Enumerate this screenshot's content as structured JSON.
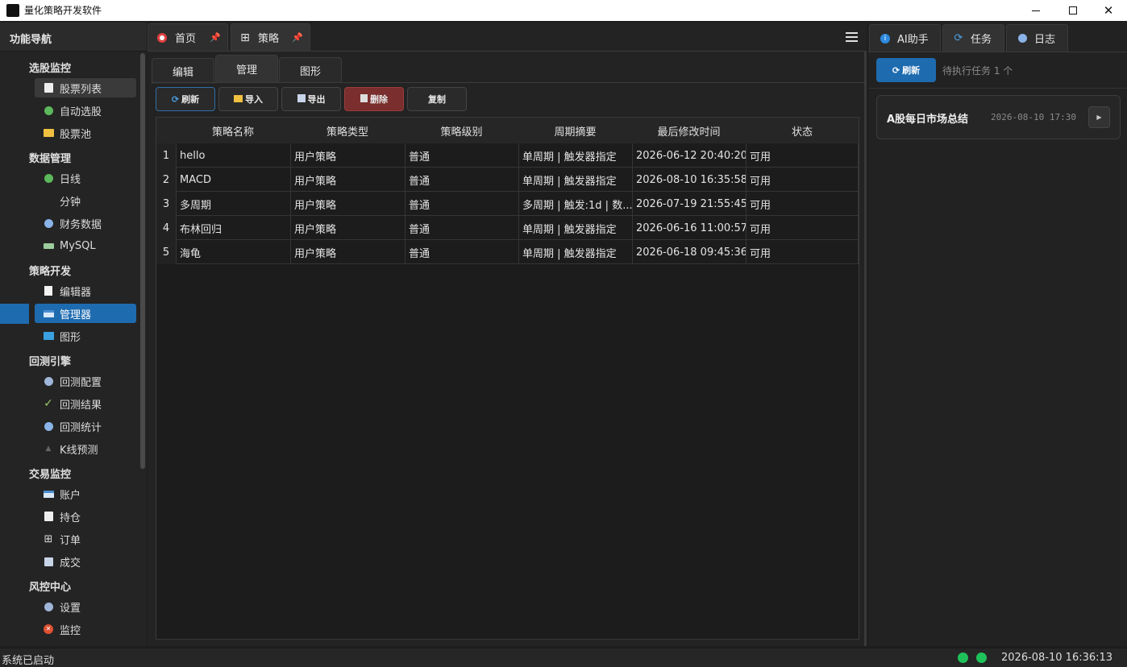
{
  "window": {
    "title": "量化策略开发软件"
  },
  "nav": {
    "header": "功能导航",
    "groups": [
      {
        "label": "选股监控",
        "items": [
          "股票列表",
          "自动选股",
          "股票池"
        ]
      },
      {
        "label": "数据管理",
        "items": [
          "日线",
          "分钟",
          "财务数据",
          "MySQL"
        ]
      },
      {
        "label": "策略开发",
        "items": [
          "编辑器",
          "管理器",
          "图形"
        ]
      },
      {
        "label": "回测引擎",
        "items": [
          "回测配置",
          "回测结果",
          "回测统计",
          "K线预测"
        ]
      },
      {
        "label": "交易监控",
        "items": [
          "账户",
          "持仓",
          "订单",
          "成交"
        ]
      },
      {
        "label": "风控中心",
        "items": [
          "设置",
          "监控"
        ]
      }
    ],
    "selected": "管理器",
    "hovered": "股票列表"
  },
  "tabs": {
    "home": "首页",
    "strategy": "策略"
  },
  "subtabs": {
    "edit": "编辑",
    "manage": "管理",
    "chart": "图形"
  },
  "toolbar": {
    "refresh": "刷新",
    "import": "导入",
    "export": "导出",
    "delete": "删除",
    "copy": "复制"
  },
  "table": {
    "columns": [
      "策略名称",
      "策略类型",
      "策略级别",
      "周期摘要",
      "最后修改时间",
      "状态"
    ],
    "rows": [
      {
        "num": "1",
        "name": "hello",
        "type": "用户策略",
        "level": "普通",
        "period": "单周期 | 触发器指定",
        "modified": "2026-06-12 20:40:20",
        "status": "可用"
      },
      {
        "num": "2",
        "name": "MACD",
        "type": "用户策略",
        "level": "普通",
        "period": "单周期 | 触发器指定",
        "modified": "2026-08-10 16:35:58",
        "status": "可用"
      },
      {
        "num": "3",
        "name": "多周期",
        "type": "用户策略",
        "level": "普通",
        "period": "多周期 | 触发:1d | 数...",
        "modified": "2026-07-19 21:55:45",
        "status": "可用"
      },
      {
        "num": "4",
        "name": "布林回归",
        "type": "用户策略",
        "level": "普通",
        "period": "单周期 | 触发器指定",
        "modified": "2026-06-16 11:00:57",
        "status": "可用"
      },
      {
        "num": "5",
        "name": "海龟",
        "type": "用户策略",
        "level": "普通",
        "period": "单周期 | 触发器指定",
        "modified": "2026-06-18 09:45:36",
        "status": "可用"
      }
    ]
  },
  "right": {
    "tabs": {
      "ai": "AI助手",
      "task": "任务",
      "log": "日志"
    },
    "refresh": "刷新",
    "pending": "待执行任务 1 个",
    "task": {
      "name": "A股每日市场总结",
      "time": "2026-08-10 17:30"
    }
  },
  "status": {
    "text": "系统已启动",
    "clock": "2026-08-10 16:36:13"
  },
  "colors": {
    "accent": "#1e6bb0",
    "delete": "#7a2e2e",
    "ok": "#1fc25a"
  }
}
